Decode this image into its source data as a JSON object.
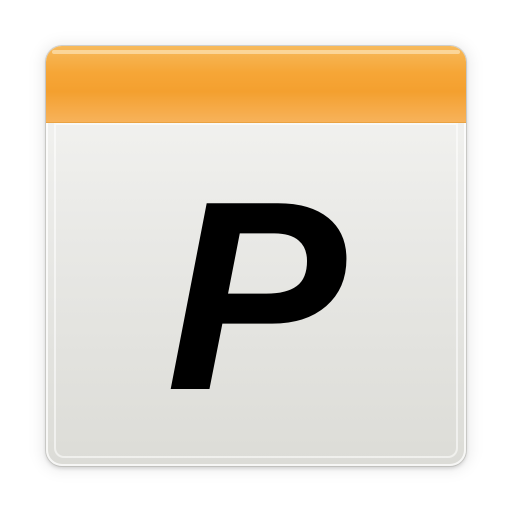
{
  "app_icon": {
    "glyph": "P",
    "header_color": "#f6a637",
    "body_color": "#e6e6e2",
    "glyph_color": "#000000"
  }
}
